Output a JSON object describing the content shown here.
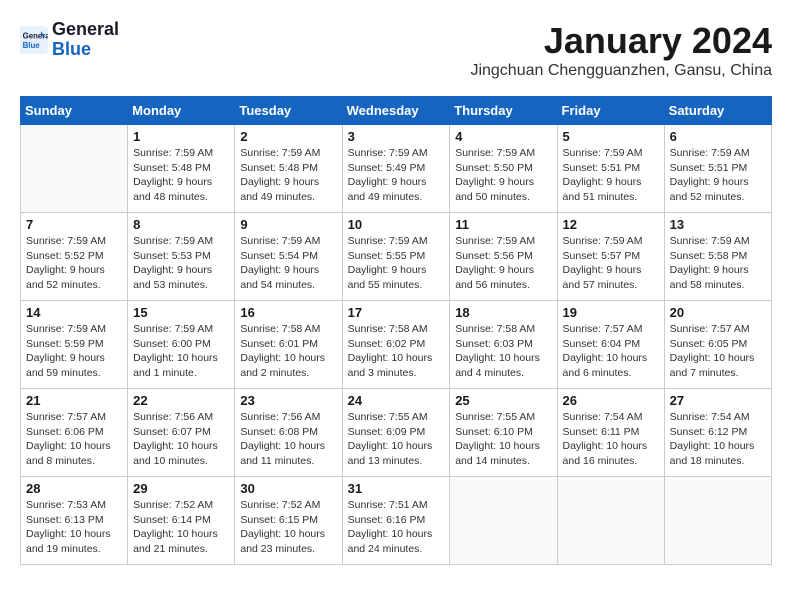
{
  "header": {
    "logo_line1": "General",
    "logo_line2": "Blue",
    "month": "January 2024",
    "location": "Jingchuan Chengguanzhen, Gansu, China"
  },
  "weekdays": [
    "Sunday",
    "Monday",
    "Tuesday",
    "Wednesday",
    "Thursday",
    "Friday",
    "Saturday"
  ],
  "weeks": [
    [
      {
        "day": "",
        "details": []
      },
      {
        "day": "1",
        "details": [
          "Sunrise: 7:59 AM",
          "Sunset: 5:48 PM",
          "Daylight: 9 hours",
          "and 48 minutes."
        ]
      },
      {
        "day": "2",
        "details": [
          "Sunrise: 7:59 AM",
          "Sunset: 5:48 PM",
          "Daylight: 9 hours",
          "and 49 minutes."
        ]
      },
      {
        "day": "3",
        "details": [
          "Sunrise: 7:59 AM",
          "Sunset: 5:49 PM",
          "Daylight: 9 hours",
          "and 49 minutes."
        ]
      },
      {
        "day": "4",
        "details": [
          "Sunrise: 7:59 AM",
          "Sunset: 5:50 PM",
          "Daylight: 9 hours",
          "and 50 minutes."
        ]
      },
      {
        "day": "5",
        "details": [
          "Sunrise: 7:59 AM",
          "Sunset: 5:51 PM",
          "Daylight: 9 hours",
          "and 51 minutes."
        ]
      },
      {
        "day": "6",
        "details": [
          "Sunrise: 7:59 AM",
          "Sunset: 5:51 PM",
          "Daylight: 9 hours",
          "and 52 minutes."
        ]
      }
    ],
    [
      {
        "day": "7",
        "details": [
          "Sunrise: 7:59 AM",
          "Sunset: 5:52 PM",
          "Daylight: 9 hours",
          "and 52 minutes."
        ]
      },
      {
        "day": "8",
        "details": [
          "Sunrise: 7:59 AM",
          "Sunset: 5:53 PM",
          "Daylight: 9 hours",
          "and 53 minutes."
        ]
      },
      {
        "day": "9",
        "details": [
          "Sunrise: 7:59 AM",
          "Sunset: 5:54 PM",
          "Daylight: 9 hours",
          "and 54 minutes."
        ]
      },
      {
        "day": "10",
        "details": [
          "Sunrise: 7:59 AM",
          "Sunset: 5:55 PM",
          "Daylight: 9 hours",
          "and 55 minutes."
        ]
      },
      {
        "day": "11",
        "details": [
          "Sunrise: 7:59 AM",
          "Sunset: 5:56 PM",
          "Daylight: 9 hours",
          "and 56 minutes."
        ]
      },
      {
        "day": "12",
        "details": [
          "Sunrise: 7:59 AM",
          "Sunset: 5:57 PM",
          "Daylight: 9 hours",
          "and 57 minutes."
        ]
      },
      {
        "day": "13",
        "details": [
          "Sunrise: 7:59 AM",
          "Sunset: 5:58 PM",
          "Daylight: 9 hours",
          "and 58 minutes."
        ]
      }
    ],
    [
      {
        "day": "14",
        "details": [
          "Sunrise: 7:59 AM",
          "Sunset: 5:59 PM",
          "Daylight: 9 hours",
          "and 59 minutes."
        ]
      },
      {
        "day": "15",
        "details": [
          "Sunrise: 7:59 AM",
          "Sunset: 6:00 PM",
          "Daylight: 10 hours",
          "and 1 minute."
        ]
      },
      {
        "day": "16",
        "details": [
          "Sunrise: 7:58 AM",
          "Sunset: 6:01 PM",
          "Daylight: 10 hours",
          "and 2 minutes."
        ]
      },
      {
        "day": "17",
        "details": [
          "Sunrise: 7:58 AM",
          "Sunset: 6:02 PM",
          "Daylight: 10 hours",
          "and 3 minutes."
        ]
      },
      {
        "day": "18",
        "details": [
          "Sunrise: 7:58 AM",
          "Sunset: 6:03 PM",
          "Daylight: 10 hours",
          "and 4 minutes."
        ]
      },
      {
        "day": "19",
        "details": [
          "Sunrise: 7:57 AM",
          "Sunset: 6:04 PM",
          "Daylight: 10 hours",
          "and 6 minutes."
        ]
      },
      {
        "day": "20",
        "details": [
          "Sunrise: 7:57 AM",
          "Sunset: 6:05 PM",
          "Daylight: 10 hours",
          "and 7 minutes."
        ]
      }
    ],
    [
      {
        "day": "21",
        "details": [
          "Sunrise: 7:57 AM",
          "Sunset: 6:06 PM",
          "Daylight: 10 hours",
          "and 8 minutes."
        ]
      },
      {
        "day": "22",
        "details": [
          "Sunrise: 7:56 AM",
          "Sunset: 6:07 PM",
          "Daylight: 10 hours",
          "and 10 minutes."
        ]
      },
      {
        "day": "23",
        "details": [
          "Sunrise: 7:56 AM",
          "Sunset: 6:08 PM",
          "Daylight: 10 hours",
          "and 11 minutes."
        ]
      },
      {
        "day": "24",
        "details": [
          "Sunrise: 7:55 AM",
          "Sunset: 6:09 PM",
          "Daylight: 10 hours",
          "and 13 minutes."
        ]
      },
      {
        "day": "25",
        "details": [
          "Sunrise: 7:55 AM",
          "Sunset: 6:10 PM",
          "Daylight: 10 hours",
          "and 14 minutes."
        ]
      },
      {
        "day": "26",
        "details": [
          "Sunrise: 7:54 AM",
          "Sunset: 6:11 PM",
          "Daylight: 10 hours",
          "and 16 minutes."
        ]
      },
      {
        "day": "27",
        "details": [
          "Sunrise: 7:54 AM",
          "Sunset: 6:12 PM",
          "Daylight: 10 hours",
          "and 18 minutes."
        ]
      }
    ],
    [
      {
        "day": "28",
        "details": [
          "Sunrise: 7:53 AM",
          "Sunset: 6:13 PM",
          "Daylight: 10 hours",
          "and 19 minutes."
        ]
      },
      {
        "day": "29",
        "details": [
          "Sunrise: 7:52 AM",
          "Sunset: 6:14 PM",
          "Daylight: 10 hours",
          "and 21 minutes."
        ]
      },
      {
        "day": "30",
        "details": [
          "Sunrise: 7:52 AM",
          "Sunset: 6:15 PM",
          "Daylight: 10 hours",
          "and 23 minutes."
        ]
      },
      {
        "day": "31",
        "details": [
          "Sunrise: 7:51 AM",
          "Sunset: 6:16 PM",
          "Daylight: 10 hours",
          "and 24 minutes."
        ]
      },
      {
        "day": "",
        "details": []
      },
      {
        "day": "",
        "details": []
      },
      {
        "day": "",
        "details": []
      }
    ]
  ]
}
